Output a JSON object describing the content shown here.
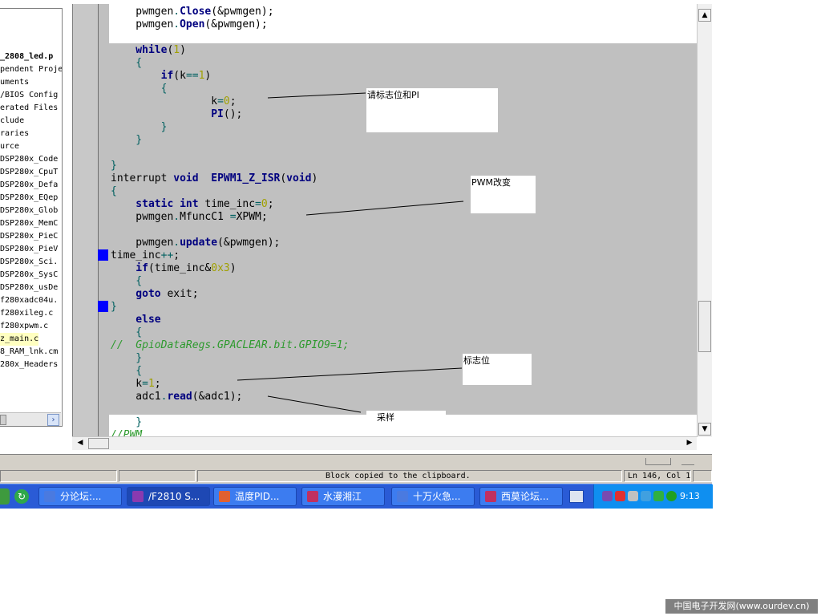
{
  "project_tree": {
    "items": [
      {
        "label": "_2808_led.p",
        "bold": true,
        "selected": false
      },
      {
        "label": "pendent Proje",
        "bold": false,
        "selected": false
      },
      {
        "label": "uments",
        "bold": false,
        "selected": false
      },
      {
        "label": "/BIOS Config",
        "bold": false,
        "selected": false
      },
      {
        "label": "erated Files",
        "bold": false,
        "selected": false
      },
      {
        "label": "clude",
        "bold": false,
        "selected": false
      },
      {
        "label": "raries",
        "bold": false,
        "selected": false
      },
      {
        "label": "urce",
        "bold": false,
        "selected": false
      },
      {
        "label": " DSP280x_Code",
        "bold": false,
        "selected": false
      },
      {
        "label": " DSP280x_CpuT",
        "bold": false,
        "selected": false
      },
      {
        "label": " DSP280x_Defa",
        "bold": false,
        "selected": false
      },
      {
        "label": " DSP280x_EQep",
        "bold": false,
        "selected": false
      },
      {
        "label": " DSP280x_Glob",
        "bold": false,
        "selected": false
      },
      {
        "label": " DSP280x_MemC",
        "bold": false,
        "selected": false
      },
      {
        "label": " DSP280x_PieC",
        "bold": false,
        "selected": false
      },
      {
        "label": " DSP280x_PieV",
        "bold": false,
        "selected": false
      },
      {
        "label": " DSP280x_Sci.",
        "bold": false,
        "selected": false
      },
      {
        "label": " DSP280x_SysC",
        "bold": false,
        "selected": false
      },
      {
        "label": " DSP280x_usDe",
        "bold": false,
        "selected": false
      },
      {
        "label": " f280xadc04u.",
        "bold": false,
        "selected": false
      },
      {
        "label": " f280xileg.c",
        "bold": false,
        "selected": false
      },
      {
        "label": " f280xpwm.c",
        "bold": false,
        "selected": false
      },
      {
        "label": " z_main.c",
        "bold": false,
        "selected": true
      },
      {
        "label": "8_RAM_lnk.cm",
        "bold": false,
        "selected": false
      },
      {
        "label": "280x_Headers",
        "bold": false,
        "selected": false
      }
    ]
  },
  "code_lines": [
    [
      [
        "",
        "    pwmgen"
      ],
      [
        "op",
        "."
      ],
      [
        "kw",
        "Close"
      ],
      [
        "",
        "(&pwmgen);"
      ]
    ],
    [
      [
        "",
        "    pwmgen"
      ],
      [
        "op",
        "."
      ],
      [
        "kw",
        "Open"
      ],
      [
        "",
        "(&pwmgen);"
      ]
    ],
    [
      [
        "",
        ""
      ]
    ],
    [
      [
        "kw",
        "    while"
      ],
      [
        "",
        "("
      ],
      [
        "num",
        "1"
      ],
      [
        "",
        ")"
      ]
    ],
    [
      [
        "op",
        "    {"
      ]
    ],
    [
      [
        "kw",
        "        if"
      ],
      [
        "",
        "(k"
      ],
      [
        "op",
        "=="
      ],
      [
        "num",
        "1"
      ],
      [
        "",
        ")"
      ]
    ],
    [
      [
        "op",
        "        {"
      ]
    ],
    [
      [
        "",
        "                k"
      ],
      [
        "op",
        "="
      ],
      [
        "num",
        "0"
      ],
      [
        "",
        ";"
      ]
    ],
    [
      [
        "kw",
        "                PI"
      ],
      [
        "",
        "();"
      ]
    ],
    [
      [
        "op",
        "        }"
      ]
    ],
    [
      [
        "op",
        "    }"
      ]
    ],
    [
      [
        "",
        ""
      ]
    ],
    [
      [
        "op",
        "}"
      ]
    ],
    [
      [
        "",
        "interrupt "
      ],
      [
        "kw",
        "void"
      ],
      [
        "",
        "  "
      ],
      [
        "kw",
        "EPWM1_Z_ISR"
      ],
      [
        "",
        "("
      ],
      [
        "kw",
        "void"
      ],
      [
        "",
        ")"
      ]
    ],
    [
      [
        "op",
        "{"
      ]
    ],
    [
      [
        "kw",
        "    static int"
      ],
      [
        "",
        " time_inc"
      ],
      [
        "op",
        "="
      ],
      [
        "num",
        "0"
      ],
      [
        "",
        ";"
      ]
    ],
    [
      [
        "",
        "    pwmgen"
      ],
      [
        "op",
        "."
      ],
      [
        "",
        "MfuncC1 "
      ],
      [
        "op",
        "="
      ],
      [
        "",
        "XPWM;"
      ]
    ],
    [
      [
        "",
        ""
      ]
    ],
    [
      [
        "",
        "    pwmgen"
      ],
      [
        "op",
        "."
      ],
      [
        "kw",
        "update"
      ],
      [
        "",
        "(&pwmgen);"
      ]
    ],
    [
      [
        "",
        "time_inc"
      ],
      [
        "op",
        "++"
      ],
      [
        "",
        ";"
      ]
    ],
    [
      [
        "kw",
        "    if"
      ],
      [
        "",
        "(time_inc&"
      ],
      [
        "num",
        "0x3"
      ],
      [
        "",
        ")"
      ]
    ],
    [
      [
        "op",
        "    {"
      ]
    ],
    [
      [
        "kw",
        "    goto"
      ],
      [
        "",
        " exit;"
      ]
    ],
    [
      [
        "op",
        "}"
      ]
    ],
    [
      [
        "kw",
        "    else"
      ]
    ],
    [
      [
        "op",
        "    {"
      ]
    ],
    [
      [
        "cmt",
        "//  GpioDataRegs.GPACLEAR.bit.GPIO9=1;"
      ]
    ],
    [
      [
        "op",
        "    }"
      ]
    ],
    [
      [
        "op",
        "    {"
      ]
    ],
    [
      [
        "",
        "    k"
      ],
      [
        "op",
        "="
      ],
      [
        "num",
        "1"
      ],
      [
        "",
        ";"
      ]
    ],
    [
      [
        "",
        "    adc1"
      ],
      [
        "op",
        "."
      ],
      [
        "kw",
        "read"
      ],
      [
        "",
        "(&adc1);"
      ]
    ],
    [
      [
        "",
        ""
      ]
    ],
    [
      [
        "op",
        "    }"
      ]
    ],
    [
      [
        "cmt",
        "//PWM"
      ]
    ]
  ],
  "annotations": {
    "flag_pi": "请标志位和PI",
    "pwm_change": "PWM改变",
    "flag": "标志位",
    "sample": "采样"
  },
  "status": {
    "message": "Block copied to the clipboard.",
    "position": "Ln 146, Col 1"
  },
  "taskbar": {
    "items": [
      {
        "label": "分论坛:...",
        "color": "#4a7ae0"
      },
      {
        "label": "/F2810 S...",
        "color": "#8a3ab0"
      },
      {
        "label": "温度PID...",
        "color": "#e06030"
      },
      {
        "label": "水漫湘江",
        "color": "#c03060"
      },
      {
        "label": "十万火急...",
        "color": "#4a7ae0"
      },
      {
        "label": "西莫论坛...",
        "color": "#c03060"
      }
    ],
    "clock": "9:13"
  },
  "watermark": "中国电子开发网(www.ourdev.cn)"
}
